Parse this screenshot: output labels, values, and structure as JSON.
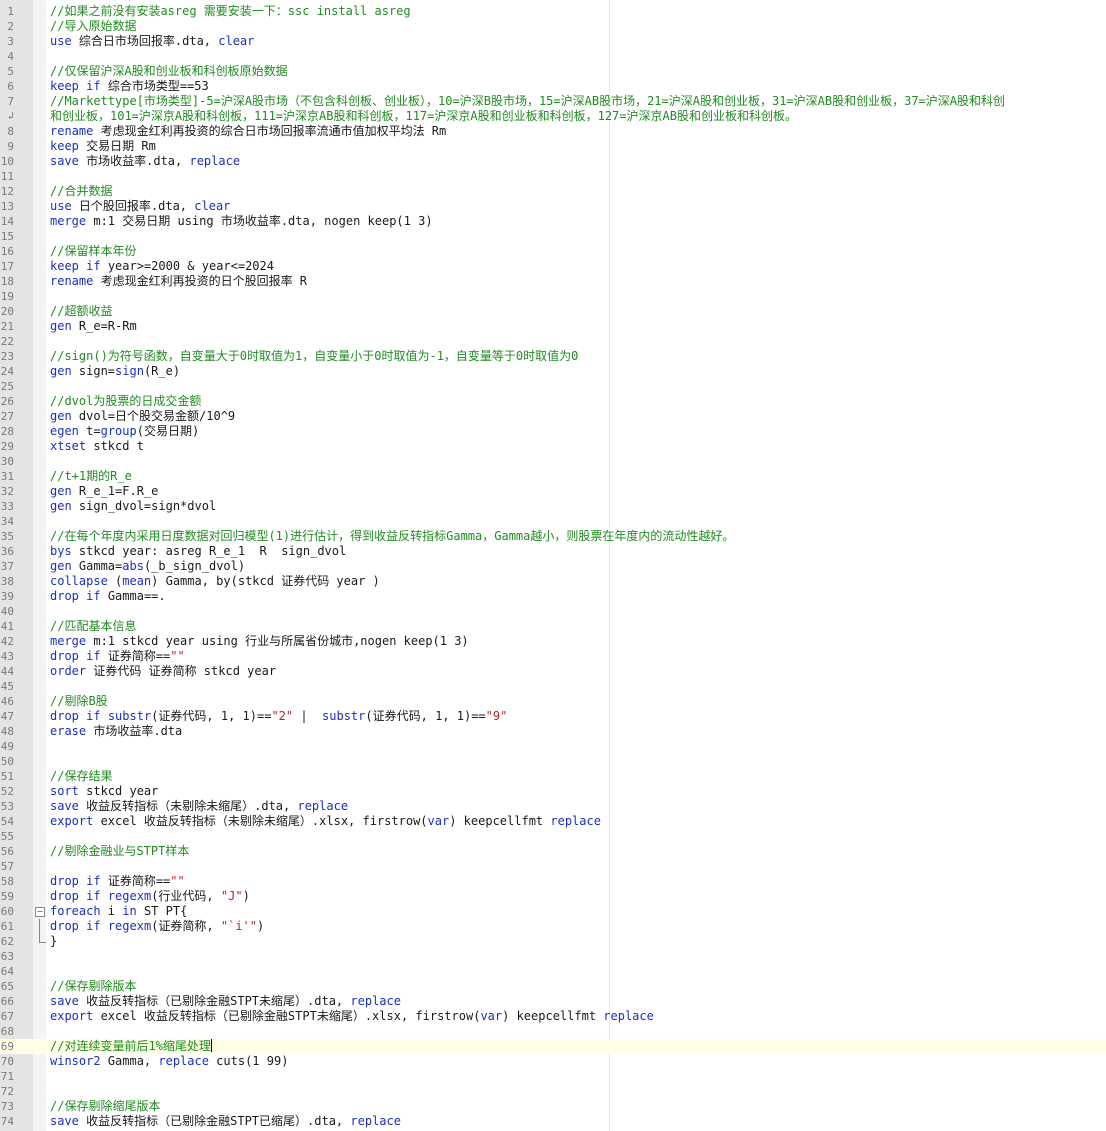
{
  "editor": {
    "current_line": 69,
    "fold_start_line": 60,
    "fold_body_lines": [
      61
    ],
    "fold_end_line": 62,
    "lines": [
      {
        "n": "1",
        "t": [
          [
            "c",
            "//如果之前没有安装asreg 需要安装一下：ssc install asreg"
          ]
        ]
      },
      {
        "n": "2",
        "t": [
          [
            "c",
            "//导入原始数据"
          ]
        ]
      },
      {
        "n": "3",
        "t": [
          [
            "kw",
            "use"
          ],
          [
            "p",
            " 综合日市场回报率.dta, "
          ],
          [
            "kw",
            "clear"
          ]
        ]
      },
      {
        "n": "4",
        "t": []
      },
      {
        "n": "5",
        "t": [
          [
            "c",
            "//仅保留沪深A股和创业板和科创板原始数据"
          ]
        ]
      },
      {
        "n": "6",
        "t": [
          [
            "kw",
            "keep"
          ],
          [
            "p",
            " "
          ],
          [
            "kw",
            "if"
          ],
          [
            "p",
            " 综合市场类型==53"
          ]
        ]
      },
      {
        "n": "7",
        "t": [
          [
            "c",
            "//Markettype[市场类型]-5=沪深A股市场（不包含科创板、创业板），10=沪深B股市场，15=沪深AB股市场，21=沪深A股和创业板，31=沪深AB股和创业板，37=沪深A股和科创"
          ]
        ]
      },
      {
        "n": "",
        "wrap": true,
        "t": [
          [
            "c",
            "和创业板，101=沪深京A股和科创板，111=沪深京AB股和科创板，117=沪深京A股和创业板和科创板，127=沪深京AB股和创业板和科创板。"
          ]
        ]
      },
      {
        "n": "8",
        "t": [
          [
            "kw",
            "rename"
          ],
          [
            "p",
            " 考虑现金红利再投资的综合日市场回报率流通市值加权平均法 Rm"
          ]
        ]
      },
      {
        "n": "9",
        "t": [
          [
            "kw",
            "keep"
          ],
          [
            "p",
            " 交易日期 Rm"
          ]
        ]
      },
      {
        "n": "10",
        "t": [
          [
            "kw",
            "save"
          ],
          [
            "p",
            " 市场收益率.dta, "
          ],
          [
            "kw",
            "replace"
          ]
        ]
      },
      {
        "n": "11",
        "t": []
      },
      {
        "n": "12",
        "t": [
          [
            "c",
            "//合并数据"
          ]
        ]
      },
      {
        "n": "13",
        "t": [
          [
            "kw",
            "use"
          ],
          [
            "p",
            " 日个股回报率.dta, "
          ],
          [
            "kw",
            "clear"
          ]
        ]
      },
      {
        "n": "14",
        "t": [
          [
            "kw",
            "merge"
          ],
          [
            "p",
            " m:1 交易日期 using 市场收益率.dta, nogen keep(1 3)"
          ]
        ]
      },
      {
        "n": "15",
        "t": []
      },
      {
        "n": "16",
        "t": [
          [
            "c",
            "//保留样本年份"
          ]
        ]
      },
      {
        "n": "17",
        "t": [
          [
            "kw",
            "keep"
          ],
          [
            "p",
            " "
          ],
          [
            "kw",
            "if"
          ],
          [
            "p",
            " year>=2000 & year<=2024"
          ]
        ]
      },
      {
        "n": "18",
        "t": [
          [
            "kw",
            "rename"
          ],
          [
            "p",
            " 考虑现金红利再投资的日个股回报率 R"
          ]
        ]
      },
      {
        "n": "19",
        "t": []
      },
      {
        "n": "20",
        "t": [
          [
            "c",
            "//超额收益"
          ]
        ]
      },
      {
        "n": "21",
        "t": [
          [
            "kw",
            "gen"
          ],
          [
            "p",
            " R_e=R-Rm"
          ]
        ]
      },
      {
        "n": "22",
        "t": []
      },
      {
        "n": "23",
        "t": [
          [
            "c",
            "//sign()为符号函数，自变量大于0时取值为1，自变量小于0时取值为-1，自变量等于0时取值为0"
          ]
        ]
      },
      {
        "n": "24",
        "t": [
          [
            "kw",
            "gen"
          ],
          [
            "p",
            " sign="
          ],
          [
            "fn",
            "sign"
          ],
          [
            "p",
            "(R_e)"
          ]
        ]
      },
      {
        "n": "25",
        "t": []
      },
      {
        "n": "26",
        "t": [
          [
            "c",
            "//dvol为股票的日成交金额"
          ]
        ]
      },
      {
        "n": "27",
        "t": [
          [
            "kw",
            "gen"
          ],
          [
            "p",
            " dvol=日个股交易金额/10^9"
          ]
        ]
      },
      {
        "n": "28",
        "t": [
          [
            "kw",
            "egen"
          ],
          [
            "p",
            " t="
          ],
          [
            "fn",
            "group"
          ],
          [
            "p",
            "(交易日期)"
          ]
        ]
      },
      {
        "n": "29",
        "t": [
          [
            "kw",
            "xtset"
          ],
          [
            "p",
            " stkcd t"
          ]
        ]
      },
      {
        "n": "30",
        "t": []
      },
      {
        "n": "31",
        "t": [
          [
            "c",
            "//t+1期的R_e"
          ]
        ]
      },
      {
        "n": "32",
        "t": [
          [
            "kw",
            "gen"
          ],
          [
            "p",
            " R_e_1=F.R_e"
          ]
        ]
      },
      {
        "n": "33",
        "t": [
          [
            "kw",
            "gen"
          ],
          [
            "p",
            " sign_dvol=sign*dvol"
          ]
        ]
      },
      {
        "n": "34",
        "t": []
      },
      {
        "n": "35",
        "t": [
          [
            "c",
            "//在每个年度内采用日度数据对回归模型(1)进行估计，得到收益反转指标Gamma，Gamma越小，则股票在年度内的流动性越好。"
          ]
        ]
      },
      {
        "n": "36",
        "t": [
          [
            "kw",
            "bys"
          ],
          [
            "p",
            " stkcd year: asreg R_e_1  R  sign_dvol"
          ]
        ]
      },
      {
        "n": "37",
        "t": [
          [
            "kw",
            "gen"
          ],
          [
            "p",
            " Gamma="
          ],
          [
            "fn",
            "abs"
          ],
          [
            "p",
            "(_b_sign_dvol)"
          ]
        ]
      },
      {
        "n": "38",
        "t": [
          [
            "kw",
            "collapse"
          ],
          [
            "p",
            " ("
          ],
          [
            "kw",
            "mean"
          ],
          [
            "p",
            ") Gamma, by(stkcd 证券代码 year )"
          ]
        ]
      },
      {
        "n": "39",
        "t": [
          [
            "kw",
            "drop"
          ],
          [
            "p",
            " "
          ],
          [
            "kw",
            "if"
          ],
          [
            "p",
            " Gamma==."
          ]
        ]
      },
      {
        "n": "40",
        "t": []
      },
      {
        "n": "41",
        "t": [
          [
            "c",
            "//匹配基本信息"
          ]
        ]
      },
      {
        "n": "42",
        "t": [
          [
            "kw",
            "merge"
          ],
          [
            "p",
            " m:1 stkcd year using 行业与所属省份城市,nogen keep(1 3)"
          ]
        ]
      },
      {
        "n": "43",
        "t": [
          [
            "kw",
            "drop"
          ],
          [
            "p",
            " "
          ],
          [
            "kw",
            "if"
          ],
          [
            "p",
            " 证券简称=="
          ],
          [
            "st",
            "\"\""
          ]
        ]
      },
      {
        "n": "44",
        "t": [
          [
            "kw",
            "order"
          ],
          [
            "p",
            " 证券代码 证券简称 stkcd year"
          ]
        ]
      },
      {
        "n": "45",
        "t": []
      },
      {
        "n": "46",
        "t": [
          [
            "c",
            "//剔除B股"
          ]
        ]
      },
      {
        "n": "47",
        "t": [
          [
            "kw",
            "drop"
          ],
          [
            "p",
            " "
          ],
          [
            "kw",
            "if"
          ],
          [
            "p",
            " "
          ],
          [
            "fn",
            "substr"
          ],
          [
            "p",
            "(证券代码, 1, 1)=="
          ],
          [
            "st",
            "\"2\""
          ],
          [
            "p",
            " |  "
          ],
          [
            "fn",
            "substr"
          ],
          [
            "p",
            "(证券代码, 1, 1)=="
          ],
          [
            "st",
            "\"9\""
          ]
        ]
      },
      {
        "n": "48",
        "t": [
          [
            "kw",
            "erase"
          ],
          [
            "p",
            " 市场收益率.dta"
          ]
        ]
      },
      {
        "n": "49",
        "t": []
      },
      {
        "n": "50",
        "t": []
      },
      {
        "n": "51",
        "t": [
          [
            "c",
            "//保存结果"
          ]
        ]
      },
      {
        "n": "52",
        "t": [
          [
            "kw",
            "sort"
          ],
          [
            "p",
            " stkcd year"
          ]
        ]
      },
      {
        "n": "53",
        "t": [
          [
            "kw",
            "save"
          ],
          [
            "p",
            " 收益反转指标（未剔除未缩尾）.dta, "
          ],
          [
            "kw",
            "replace"
          ]
        ]
      },
      {
        "n": "54",
        "t": [
          [
            "kw",
            "export"
          ],
          [
            "p",
            " excel 收益反转指标（未剔除未缩尾）.xlsx, firstrow("
          ],
          [
            "kw",
            "var"
          ],
          [
            "p",
            ") keepcellfmt "
          ],
          [
            "kw",
            "replace"
          ]
        ]
      },
      {
        "n": "55",
        "t": []
      },
      {
        "n": "56",
        "t": [
          [
            "c",
            "//剔除金融业与STPT样本"
          ]
        ]
      },
      {
        "n": "57",
        "t": []
      },
      {
        "n": "58",
        "t": [
          [
            "kw",
            "drop"
          ],
          [
            "p",
            " "
          ],
          [
            "kw",
            "if"
          ],
          [
            "p",
            " 证券简称=="
          ],
          [
            "st",
            "\"\""
          ]
        ]
      },
      {
        "n": "59",
        "t": [
          [
            "kw",
            "drop"
          ],
          [
            "p",
            " "
          ],
          [
            "kw",
            "if"
          ],
          [
            "p",
            " "
          ],
          [
            "fn",
            "regexm"
          ],
          [
            "p",
            "(行业代码, "
          ],
          [
            "st",
            "\"J\""
          ],
          [
            "p",
            ")"
          ]
        ]
      },
      {
        "n": "60",
        "t": [
          [
            "kw",
            "foreach"
          ],
          [
            "p",
            " i "
          ],
          [
            "kw",
            "in"
          ],
          [
            "p",
            " ST PT{"
          ]
        ]
      },
      {
        "n": "61",
        "t": [
          [
            "kw",
            "drop"
          ],
          [
            "p",
            " "
          ],
          [
            "kw",
            "if"
          ],
          [
            "p",
            " "
          ],
          [
            "fn",
            "regexm"
          ],
          [
            "p",
            "(证券简称, "
          ],
          [
            "st",
            "\"`i'\""
          ],
          [
            "p",
            ")"
          ]
        ]
      },
      {
        "n": "62",
        "t": [
          [
            "p",
            "}"
          ]
        ]
      },
      {
        "n": "63",
        "t": []
      },
      {
        "n": "64",
        "t": []
      },
      {
        "n": "65",
        "t": [
          [
            "c",
            "//保存剔除版本"
          ]
        ]
      },
      {
        "n": "66",
        "t": [
          [
            "kw",
            "save"
          ],
          [
            "p",
            " 收益反转指标（已剔除金融STPT未缩尾）.dta, "
          ],
          [
            "kw",
            "replace"
          ]
        ]
      },
      {
        "n": "67",
        "t": [
          [
            "kw",
            "export"
          ],
          [
            "p",
            " excel 收益反转指标（已剔除金融STPT未缩尾）.xlsx, firstrow("
          ],
          [
            "kw",
            "var"
          ],
          [
            "p",
            ") keepcellfmt "
          ],
          [
            "kw",
            "replace"
          ]
        ]
      },
      {
        "n": "68",
        "t": []
      },
      {
        "n": "69",
        "t": [
          [
            "c",
            "//对连续变量前后1%缩尾处理"
          ]
        ]
      },
      {
        "n": "70",
        "t": [
          [
            "kw",
            "winsor2"
          ],
          [
            "p",
            " Gamma, "
          ],
          [
            "kw",
            "replace"
          ],
          [
            "p",
            " cuts(1 99)"
          ]
        ]
      },
      {
        "n": "71",
        "t": []
      },
      {
        "n": "72",
        "t": []
      },
      {
        "n": "73",
        "t": [
          [
            "c",
            "//保存剔除缩尾版本"
          ]
        ]
      },
      {
        "n": "74",
        "t": [
          [
            "kw",
            "save"
          ],
          [
            "p",
            " 收益反转指标（已剔除金融STPT已缩尾）.dta, "
          ],
          [
            "kw",
            "replace"
          ]
        ]
      }
    ]
  }
}
